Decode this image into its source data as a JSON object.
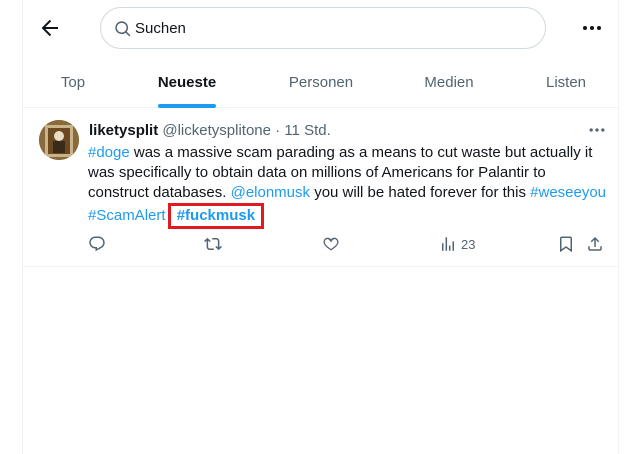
{
  "search": {
    "placeholder": "Suchen"
  },
  "tabs": [
    {
      "label": "Top"
    },
    {
      "label": "Neueste",
      "active": true
    },
    {
      "label": "Personen"
    },
    {
      "label": "Medien"
    },
    {
      "label": "Listen"
    }
  ],
  "tweet": {
    "display_name": "liketysplit",
    "handle": "@licketysplitone",
    "separator": "·",
    "time": "11 Std.",
    "text_parts": {
      "tag_doge": "#doge",
      "t1": " was a massive scam parading as a means to cut waste but actually it was specifically to obtain data on millions of Americans for Palantir to construct databases. ",
      "mention": "@elonmusk",
      "t2": " you will be hated forever for this ",
      "tag_weseeyou": "#weseeyou",
      "tag_scamalert": "#ScamAlert",
      "tag_fuckmusk": "#fuckmusk"
    },
    "views": "23"
  },
  "icons": {
    "back": "arrow-left-icon",
    "search": "search-icon",
    "more": "more-horizontal-icon",
    "reply": "reply-icon",
    "retweet": "retweet-icon",
    "like": "like-icon",
    "views": "views-icon",
    "bookmark": "bookmark-icon",
    "share": "share-icon"
  },
  "colors": {
    "accent": "#1d9bf0",
    "highlight_box": "#e11b22",
    "secondary_text": "#536471"
  }
}
